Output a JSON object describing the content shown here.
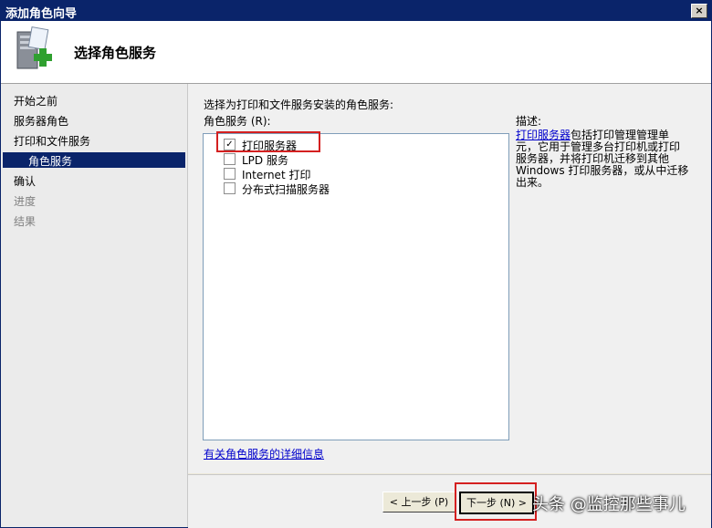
{
  "window": {
    "title": "添加角色向导",
    "close_label": "×"
  },
  "header": {
    "heading": "选择角色服务"
  },
  "sidebar": {
    "steps": [
      {
        "label": "开始之前"
      },
      {
        "label": "服务器角色"
      },
      {
        "label": "打印和文件服务"
      },
      {
        "label": "角色服务"
      },
      {
        "label": "确认"
      },
      {
        "label": "进度"
      },
      {
        "label": "结果"
      }
    ]
  },
  "main": {
    "intro": "选择为打印和文件服务安装的角色服务:",
    "list_label": "角色服务 (R):",
    "services": [
      {
        "label": "打印服务器",
        "checked": true,
        "mark": "✓"
      },
      {
        "label": "LPD 服务",
        "checked": false,
        "mark": ""
      },
      {
        "label": "Internet 打印",
        "checked": false,
        "mark": ""
      },
      {
        "label": "分布式扫描服务器",
        "checked": false,
        "mark": ""
      }
    ],
    "more_info_link": "有关角色服务的详细信息",
    "description_label": "描述:",
    "description_link": "打印服务器",
    "description_text": "包括打印管理管理单元，它用于管理多台打印机或打印服务器，并将打印机迁移到其他 Windows 打印服务器，或从中迁移出来。"
  },
  "footer": {
    "prev_label": "< 上一步 (P)",
    "next_label": "下一步 (N) >"
  },
  "watermark": "头条 @监控那些事儿",
  "colors": {
    "title_bar": "#0a246a",
    "selected_step": "#0a246a",
    "link": "#0000cc",
    "highlight": "#d42020"
  }
}
